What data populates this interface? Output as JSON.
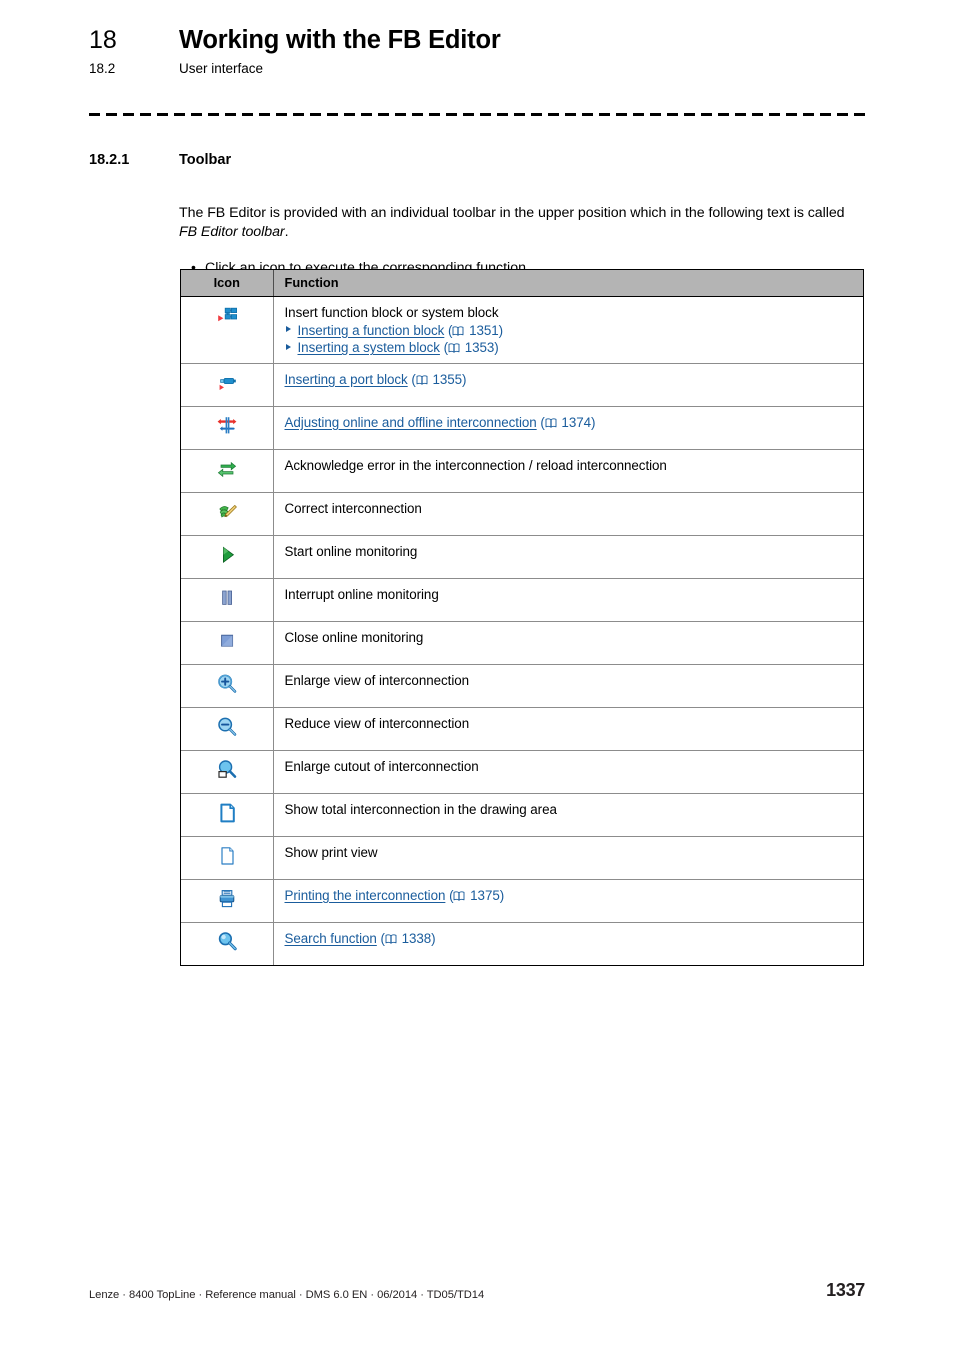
{
  "header": {
    "chapter_number": "18",
    "chapter_title": "Working with the FB Editor",
    "section_number": "18.2",
    "section_title": "User interface"
  },
  "section": {
    "number": "18.2.1",
    "title": "Toolbar",
    "paragraph_part1": "The FB Editor is provided with an individual toolbar in the upper position which in the following text is called ",
    "paragraph_italic": "FB Editor toolbar",
    "paragraph_part2": ".",
    "bullets": [
      "Click an icon to execute the corresponding function."
    ]
  },
  "table": {
    "columns": [
      "Icon",
      "Function"
    ],
    "rows": [
      {
        "icon": "insert-function-block-icon",
        "text": "Insert function block or system block",
        "sublinks": [
          {
            "label": "Inserting a function block",
            "page": "1351"
          },
          {
            "label": "Inserting a system block",
            "page": "1353"
          }
        ]
      },
      {
        "icon": "insert-port-block-icon",
        "link": {
          "label": "Inserting a port block",
          "page": "1355"
        }
      },
      {
        "icon": "adjust-online-offline-icon",
        "link": {
          "label": "Adjusting online and offline interconnection",
          "page": "1374"
        }
      },
      {
        "icon": "acknowledge-error-reload-icon",
        "text": "Acknowledge error in the interconnection / reload interconnection"
      },
      {
        "icon": "correct-interconnection-icon",
        "text": "Correct interconnection"
      },
      {
        "icon": "start-monitoring-icon",
        "text": "Start online monitoring"
      },
      {
        "icon": "pause-monitoring-icon",
        "text": "Interrupt online monitoring"
      },
      {
        "icon": "stop-monitoring-icon",
        "text": "Close online monitoring"
      },
      {
        "icon": "zoom-in-icon",
        "text": "Enlarge view of interconnection"
      },
      {
        "icon": "zoom-out-icon",
        "text": "Reduce view of interconnection"
      },
      {
        "icon": "zoom-selection-icon",
        "text": "Enlarge cutout of interconnection"
      },
      {
        "icon": "fit-to-page-icon",
        "text": "Show total interconnection in the drawing area"
      },
      {
        "icon": "print-preview-icon",
        "text": "Show print view"
      },
      {
        "icon": "printer-icon",
        "link": {
          "label": "Printing the interconnection",
          "page": "1375"
        }
      },
      {
        "icon": "search-icon",
        "link": {
          "label": "Search function",
          "page": "1338"
        }
      }
    ]
  },
  "footer": {
    "imprint": "Lenze · 8400 TopLine · Reference manual · DMS 6.0 EN · 06/2014 · TD05/TD14",
    "page_number": "1337"
  },
  "colors": {
    "link": "#1a5c9c",
    "table_header_bg": "#b4b4b4",
    "rule": "#000000"
  }
}
